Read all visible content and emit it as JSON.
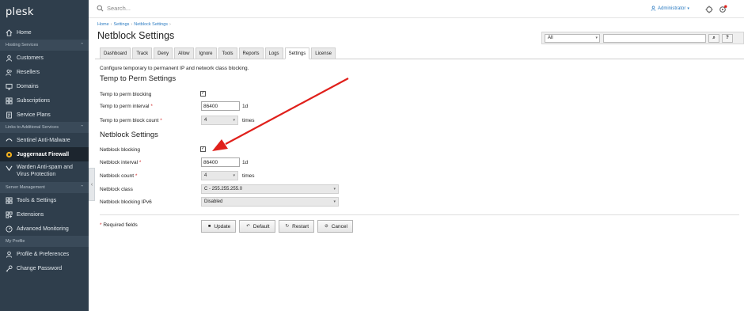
{
  "app": {
    "logo": "plesk"
  },
  "sidebar": {
    "home": "Home",
    "sections": [
      {
        "title": "Hosting Services",
        "items": [
          "Customers",
          "Resellers",
          "Domains",
          "Subscriptions",
          "Service Plans"
        ]
      },
      {
        "title": "Links to Additional Services",
        "items": [
          "Sentinel Anti-Malware",
          "Juggernaut Firewall",
          "Warden Anti-spam and Virus Protection"
        ]
      },
      {
        "title": "Server Management",
        "items": [
          "Tools & Settings",
          "Extensions",
          "Advanced Monitoring"
        ]
      },
      {
        "title": "My Profile",
        "items": [
          "Profile & Preferences",
          "Change Password"
        ]
      }
    ],
    "active": "Juggernaut Firewall",
    "collapse_glyph": "‹"
  },
  "topbar": {
    "search_placeholder": "Search...",
    "user": "Administrator"
  },
  "breadcrumb": [
    "Home",
    "Settings",
    "Netblock Settings"
  ],
  "page_title": "Netblock Settings",
  "filter": {
    "select_value": "All",
    "search_glyph": "⌕",
    "help_glyph": "?"
  },
  "tabs": [
    "Dashboard",
    "Track",
    "Deny",
    "Allow",
    "Ignore",
    "Tools",
    "Reports",
    "Logs",
    "Settings",
    "License"
  ],
  "active_tab": "Settings",
  "description": "Configure temporary to permanent IP and network class blocking.",
  "temp_to_perm": {
    "title": "Temp to Perm Settings",
    "blocking_label": "Temp to perm blocking",
    "blocking_checked": true,
    "interval_label": "Temp to perm interval",
    "interval_value": "86400",
    "interval_unit": "1d",
    "count_label": "Temp to perm block count",
    "count_value": "4",
    "count_unit": "times"
  },
  "netblock": {
    "title": "Netblock Settings",
    "blocking_label": "Netblock blocking",
    "blocking_checked": true,
    "interval_label": "Netblock interval",
    "interval_value": "86400",
    "interval_unit": "1d",
    "count_label": "Netblock count",
    "count_value": "4",
    "count_unit": "times",
    "class_label": "Netblock class",
    "class_value": "C - 255.255.255.0",
    "ipv6_label": "Netblock blocking IPv6",
    "ipv6_value": "Disabled"
  },
  "required_note": "Required fields",
  "required_mark": "*",
  "check_glyph": "✓",
  "buttons": {
    "update": "Update",
    "default": "Default",
    "restart": "Restart",
    "cancel": "Cancel"
  },
  "colors": {
    "sidebar_bg": "#2f3e4c",
    "link": "#2d7cc2",
    "required": "#d32f2f",
    "arrow": "#e0201b"
  }
}
